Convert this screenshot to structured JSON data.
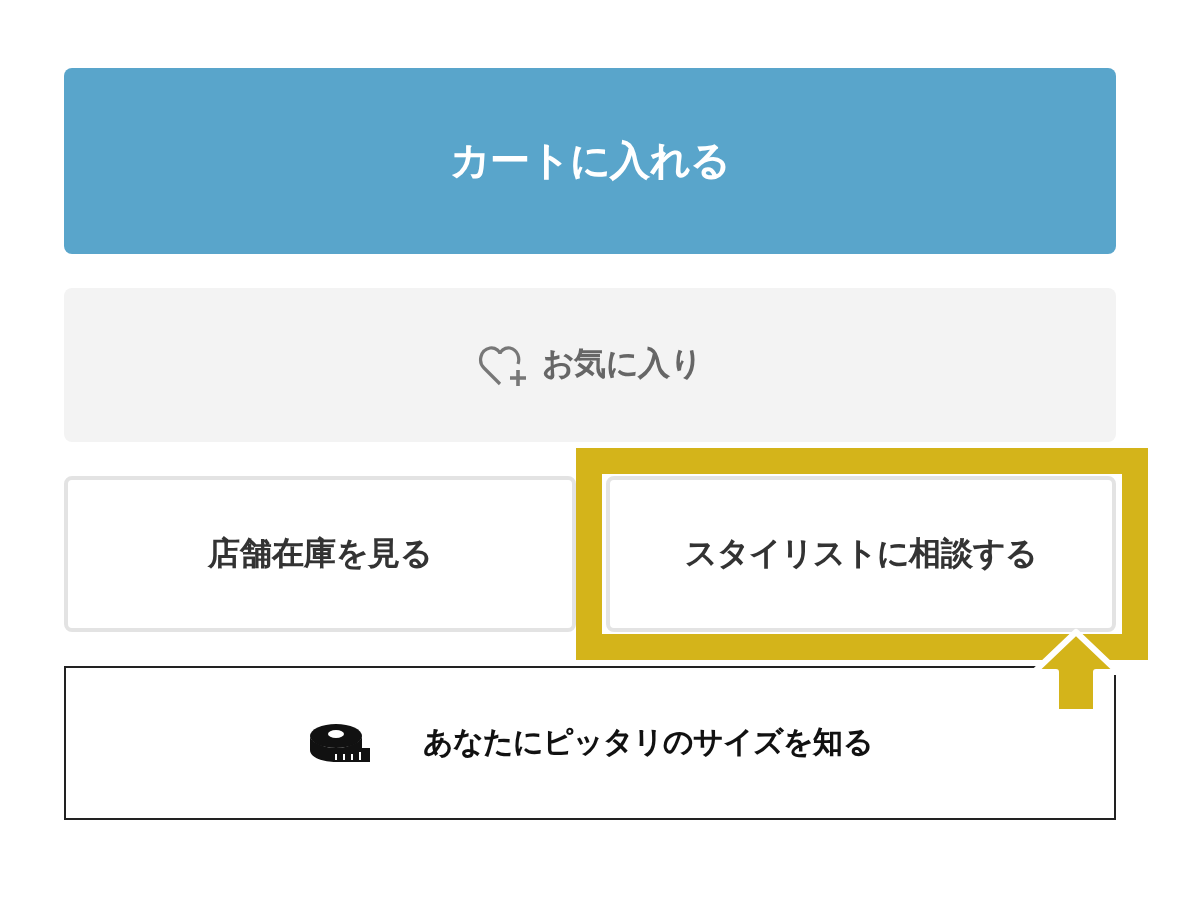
{
  "buttons": [
    {
      "kind": "primary",
      "label": "カートに入れる",
      "highlighted": false
    },
    {
      "kind": "favorite",
      "label": "お気に入り",
      "highlighted": false
    },
    {
      "kind": "half",
      "label": "店舗在庫を見る",
      "highlighted": false
    },
    {
      "kind": "half",
      "label": "スタイリストに相談する",
      "highlighted": true
    },
    {
      "kind": "size",
      "label": "あなたにピッタリのサイズを知る",
      "highlighted": false
    }
  ]
}
